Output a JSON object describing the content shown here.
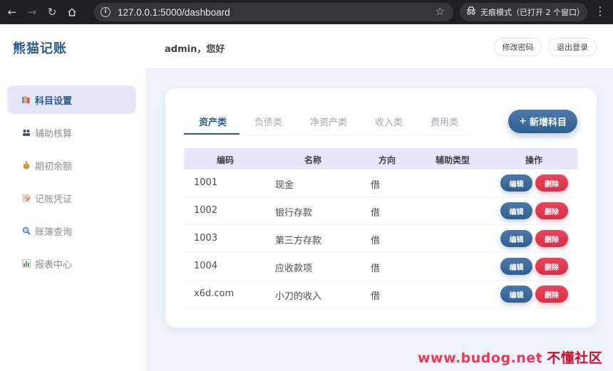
{
  "browser": {
    "url": "127.0.0.1:5000/dashboard",
    "incognito_label": "无痕模式（已打开 2 个窗口）"
  },
  "sidebar": {
    "brand": "熊猫记账",
    "items": [
      {
        "label": "科目设置",
        "icon": "books-icon",
        "active": true
      },
      {
        "label": "辅助核算",
        "icon": "people-icon",
        "active": false
      },
      {
        "label": "期初余额",
        "icon": "money-bag-icon",
        "active": false
      },
      {
        "label": "记账凭证",
        "icon": "memo-icon",
        "active": false
      },
      {
        "label": "账簿查询",
        "icon": "magnifier-icon",
        "active": false
      },
      {
        "label": "报表中心",
        "icon": "bar-chart-icon",
        "active": false
      }
    ]
  },
  "header": {
    "greeting": "admin，您好",
    "change_password_label": "修改密码",
    "logout_label": "退出登录"
  },
  "main": {
    "tabs": [
      {
        "label": "资产类",
        "active": true
      },
      {
        "label": "负债类",
        "active": false
      },
      {
        "label": "净资产类",
        "active": false
      },
      {
        "label": "收入类",
        "active": false
      },
      {
        "label": "费用类",
        "active": false
      }
    ],
    "add_button_label": "新增科目",
    "table": {
      "columns": [
        "编码",
        "名称",
        "方向",
        "辅助类型",
        "操作"
      ],
      "rows": [
        {
          "code": "1001",
          "name": "现金",
          "direction": "借",
          "aux": ""
        },
        {
          "code": "1002",
          "name": "银行存款",
          "direction": "借",
          "aux": ""
        },
        {
          "code": "1003",
          "name": "第三方存款",
          "direction": "借",
          "aux": ""
        },
        {
          "code": "1004",
          "name": "应收款项",
          "direction": "借",
          "aux": ""
        },
        {
          "code": "x6d.com",
          "name": "小刀的收入",
          "direction": "借",
          "aux": ""
        }
      ],
      "edit_label": "编辑",
      "delete_label": "删除"
    }
  },
  "watermark": {
    "text": "www.budog.net",
    "text_cn": "不懂社区"
  },
  "colors": {
    "accent": "#2b5d8c",
    "active_bg": "#e6e6f9",
    "danger": "#d72f47",
    "page_bg": "#eef3fa"
  }
}
